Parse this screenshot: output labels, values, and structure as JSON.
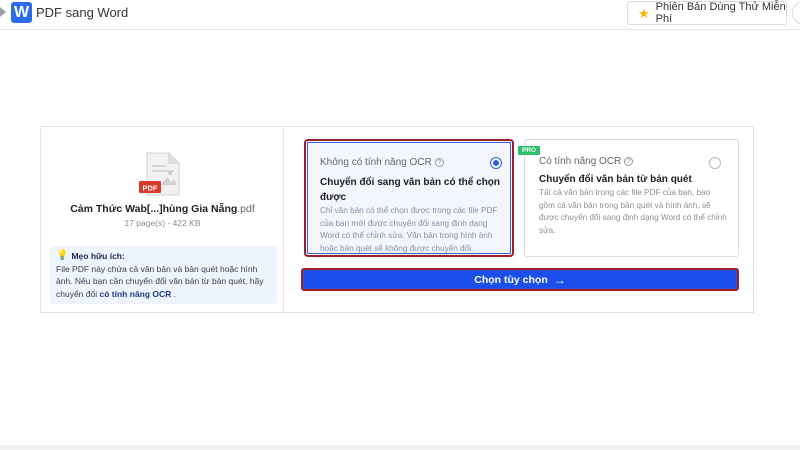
{
  "header": {
    "logo_letter": "W",
    "app_title": "PDF sang Word",
    "trial_label": "Phiên Bản Dùng Thử Miễn Phí",
    "trial_icon": "star-icon"
  },
  "file": {
    "name": "Cảm Thức Wab[...]hùng Gia Nẵng",
    "ext": ".pdf",
    "meta": "17 page(s) - 422 KB",
    "badge": "PDF"
  },
  "tip": {
    "title": "Mẹo hữu ích:",
    "text_before": "File PDF này chứa cả văn bản và bản quét hoặc hình ảnh. Nếu bạn cần chuyển đổi văn bản từ bản quét, hãy chuyển đổi ",
    "link": "có tính năng OCR",
    "text_after": " ."
  },
  "options": {
    "no_ocr": {
      "heading": "Không có tính năng OCR",
      "title": "Chuyển đổi sang văn bản có thể chọn được",
      "description": "Chỉ văn bản có thể chọn được trong các file PDF của bạn mới được chuyển đổi sang định dạng Word có thể chỉnh sửa. Văn bản trong hình ảnh hoặc bản quét sẽ không được chuyển đổi.",
      "selected": true
    },
    "ocr": {
      "badge": "PRO",
      "heading": "Có tính năng OCR",
      "title": "Chuyển đổi văn bản từ bản quét",
      "description": "Tất cả văn bản trong các file PDF của bạn, bao gồm cả văn bản trong bản quét và hình ảnh, sẽ được chuyển đổi sang định dạng Word có thể chỉnh sửa.",
      "selected": false
    }
  },
  "action": {
    "label": "Chọn tùy chọn",
    "arrow": "→"
  },
  "colors": {
    "accent": "#1a4fea",
    "highlight_border": "#a01d2d",
    "pro_badge": "#2ebd6b",
    "pdf_red": "#d93a2b"
  }
}
